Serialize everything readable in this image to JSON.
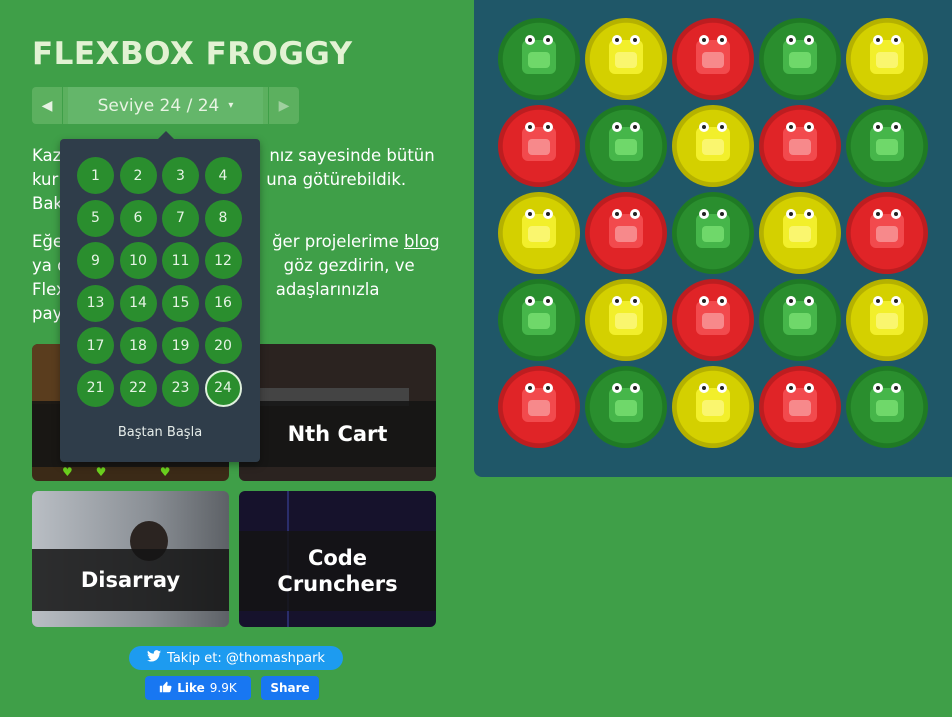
{
  "app": {
    "title": "FLEXBOX FROGGY"
  },
  "level_nav": {
    "prev_icon": "triangle-left",
    "next_icon": "triangle-right",
    "label": "Seviye 24 / 24",
    "caret": "▾"
  },
  "level_menu": {
    "levels": [
      "1",
      "2",
      "3",
      "4",
      "5",
      "6",
      "7",
      "8",
      "9",
      "10",
      "11",
      "12",
      "13",
      "14",
      "15",
      "16",
      "17",
      "18",
      "19",
      "20",
      "21",
      "22",
      "23",
      "24"
    ],
    "current": "24",
    "reset_label": "Baştan Başla"
  },
  "instructions": {
    "line1_visible": "Kaz",
    "line1_rest": "nız sayesinde bütün",
    "line2_visible": "kur",
    "line2_rest": "una götürebildik.",
    "line3_visible": "Bak",
    "para2_line1_a": "Eğe",
    "para2_line1_b": "ğer projelerime ",
    "para2_link": "blog",
    "para2_line2_a": "ya d",
    "para2_line2_b": "göz gezdirin, ve",
    "para2_line3_a": "Flex",
    "para2_line3_b": "adaşlarınızla paylaşın!"
  },
  "games": [
    {
      "title": "",
      "key": "game-1"
    },
    {
      "title": "Nth Cart",
      "key": "game-2"
    },
    {
      "title": "Disarray",
      "key": "game-3"
    },
    {
      "title": "Code Crunchers",
      "key": "game-4"
    }
  ],
  "social": {
    "twitter_label": "Takip et: @thomashpark",
    "like_label": "Like",
    "like_count": "9.9K",
    "share_label": "Share"
  },
  "colors": {
    "background": "#3f9f48",
    "board": "#1f5768",
    "green": "#2a8e2e",
    "yellow": "#d4d000",
    "red": "#e02427"
  },
  "board": {
    "rows": [
      [
        "green",
        "yellow",
        "red",
        "green",
        "yellow"
      ],
      [
        "red",
        "green",
        "yellow",
        "red",
        "green"
      ],
      [
        "yellow",
        "red",
        "green",
        "yellow",
        "red"
      ],
      [
        "green",
        "yellow",
        "red",
        "green",
        "yellow"
      ],
      [
        "red",
        "green",
        "yellow",
        "red",
        "green"
      ]
    ]
  }
}
